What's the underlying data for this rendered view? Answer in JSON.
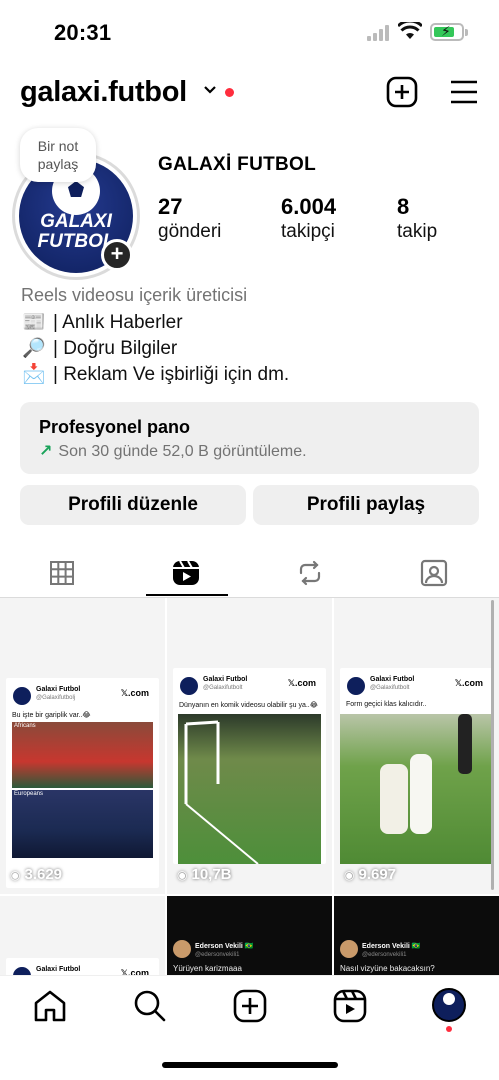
{
  "status_bar": {
    "time": "20:31"
  },
  "header": {
    "username": "galaxi.futbol",
    "icons": [
      "chevron-down-icon",
      "create-plus-icon",
      "menu-icon"
    ]
  },
  "profile": {
    "note_bubble": [
      "Bir not",
      "paylaş"
    ],
    "avatar_text": [
      "GALAXI",
      "FUTBOL"
    ],
    "display_name": "GALAXİ FUTBOL",
    "stats": [
      {
        "value": "27",
        "label": "gönderi"
      },
      {
        "value": "6.004",
        "label": "takipçi"
      },
      {
        "value": "8",
        "label": "takip"
      }
    ],
    "bio": {
      "category": "Reels videosu içerik üreticisi",
      "lines": [
        {
          "icon": "📰",
          "text": "| Anlık Haberler"
        },
        {
          "icon": "🔎",
          "text": "| Doğru Bilgiler"
        },
        {
          "icon": "📩",
          "text": "| Reklam Ve işbirliği için dm."
        }
      ]
    }
  },
  "pro_panel": {
    "title": "Profesyonel pano",
    "arrow": "↗",
    "subtitle": "Son 30 günde 52,0 B görüntüleme."
  },
  "actions": {
    "edit": "Profili düzenle",
    "share": "Profili paylaş"
  },
  "tabs": [
    "grid-icon",
    "reels-icon",
    "reposts-icon",
    "tagged-icon"
  ],
  "active_tab": 1,
  "grid": [
    {
      "author": "Galaxi Futbol",
      "handle": "@Galaxifutbolj",
      "source": "𝕏.com",
      "caption": "Bu işte bir gariplik var..😂",
      "panel_labels": [
        "Africans",
        "Europeans"
      ],
      "views": "3.629"
    },
    {
      "author": "Galaxi Futbol",
      "handle": "@Galaxifutbolt",
      "source": "𝕏.com",
      "caption": "Dünyanın en komik videosu olabilir şu ya..😂",
      "views": "10,7B"
    },
    {
      "author": "Galaxi Futbol",
      "handle": "@Galaxifutbolt",
      "source": "𝕏.com",
      "caption": "Form geçici klas kalıcıdır..",
      "views": "9.697"
    }
  ],
  "grid_row2": [
    {
      "author": "Galaxi Futbol",
      "source": "𝕏.com"
    },
    {
      "author": "Ederson Vekili 🇧🇷",
      "handle": "@edersonvekili1",
      "caption": "Yürüyen karizmaaa"
    },
    {
      "author": "Ederson Vekili 🇧🇷",
      "handle": "@edersonvekili1",
      "caption": "Nasıl vizyüne bakacaksın?"
    }
  ],
  "bottom_nav": [
    "home-icon",
    "search-icon",
    "create-icon",
    "reels-icon",
    "profile-avatar"
  ]
}
